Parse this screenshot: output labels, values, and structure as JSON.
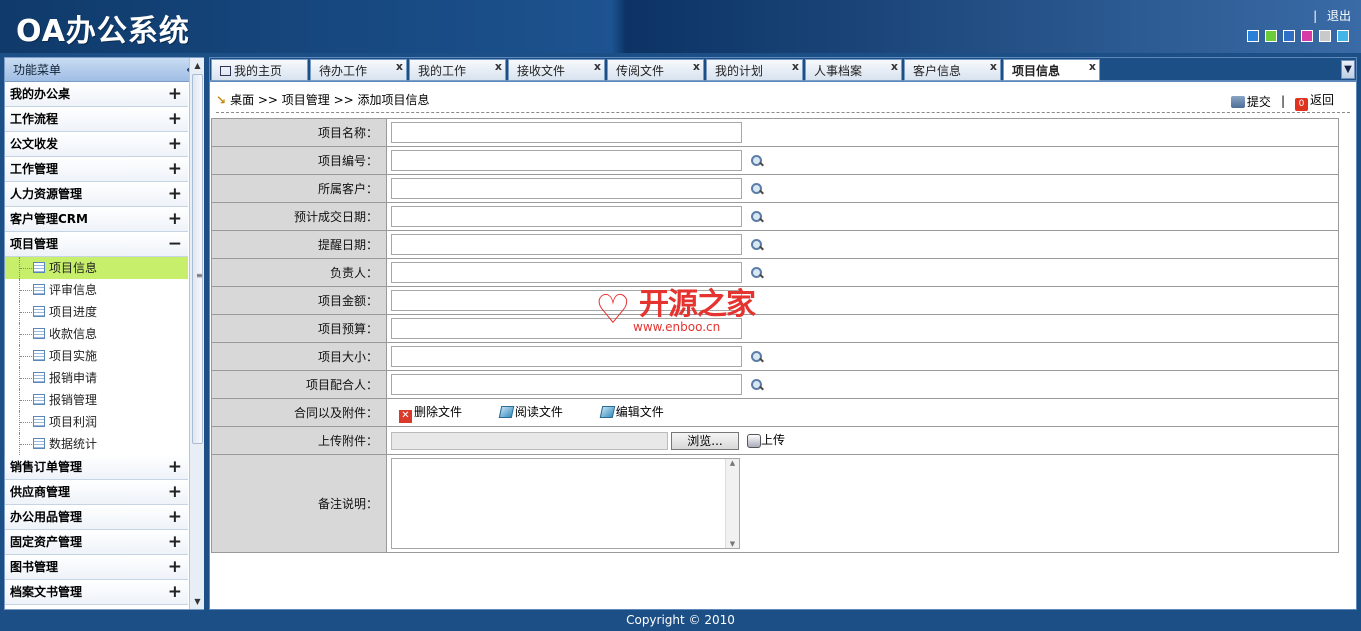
{
  "app": {
    "title": "OA办公系统",
    "logout": "退出",
    "separator": "|",
    "skins": [
      "#2a7fd6",
      "#6ccc3a",
      "#2f6fc4",
      "#d83aa6",
      "#c9c9c9",
      "#44b5e8"
    ]
  },
  "sidebar": {
    "title": "功能菜单",
    "collapse": "«",
    "groups": [
      {
        "label": "我的办公桌",
        "toggle": "+"
      },
      {
        "label": "工作流程",
        "toggle": "+"
      },
      {
        "label": "公文收发",
        "toggle": "+"
      },
      {
        "label": "工作管理",
        "toggle": "+"
      },
      {
        "label": "人力资源管理",
        "toggle": "+"
      },
      {
        "label": "客户管理CRM",
        "toggle": "+"
      },
      {
        "label": "项目管理",
        "toggle": "−"
      }
    ],
    "items": [
      "项目信息",
      "评审信息",
      "项目进度",
      "收款信息",
      "项目实施",
      "报销申请",
      "报销管理",
      "项目利润",
      "数据统计"
    ],
    "groups2": [
      {
        "label": "销售订单管理",
        "toggle": "+"
      },
      {
        "label": "供应商管理",
        "toggle": "+"
      },
      {
        "label": "办公用品管理",
        "toggle": "+"
      },
      {
        "label": "固定资产管理",
        "toggle": "+"
      },
      {
        "label": "图书管理",
        "toggle": "+"
      },
      {
        "label": "档案文书管理",
        "toggle": "+"
      }
    ]
  },
  "tabs": [
    {
      "label": "我的主页",
      "close": ""
    },
    {
      "label": "待办工作",
      "close": "x"
    },
    {
      "label": "我的工作",
      "close": "x"
    },
    {
      "label": "接收文件",
      "close": "x"
    },
    {
      "label": "传阅文件",
      "close": "x"
    },
    {
      "label": "我的计划",
      "close": "x"
    },
    {
      "label": "人事档案",
      "close": "x"
    },
    {
      "label": "客户信息",
      "close": "x"
    },
    {
      "label": "项目信息",
      "close": "x"
    }
  ],
  "breadcrumb": "桌面 >> 项目管理 >> 添加项目信息",
  "actions": {
    "submit": "提交",
    "separator": "|",
    "back": "返回",
    "back_icon_text": "0"
  },
  "form": {
    "name": "项目名称：",
    "code": "项目编号：",
    "customer": "所属客户：",
    "deal_date": "预计成交日期：",
    "remind_date": "提醒日期：",
    "owner": "负责人：",
    "amount": "项目金额：",
    "budget": "项目预算：",
    "size": "项目大小：",
    "partner": "项目配合人：",
    "contract": "合同以及附件：",
    "delete_file": "删除文件",
    "read_file": "阅读文件",
    "edit_file": "编辑文件",
    "upload_label": "上传附件：",
    "browse": "浏览...",
    "upload": "上传",
    "remark": "备注说明："
  },
  "watermark": {
    "title": "开源之家",
    "url": "www.enboo.cn"
  },
  "footer": "Copyright © 2010"
}
